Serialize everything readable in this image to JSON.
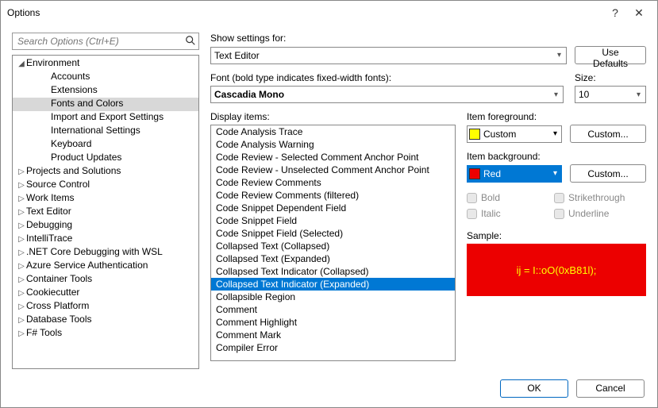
{
  "window": {
    "title": "Options",
    "help_glyph": "?",
    "close_glyph": "✕"
  },
  "search": {
    "placeholder": "Search Options (Ctrl+E)"
  },
  "tree": {
    "items": [
      {
        "label": "Environment",
        "indent": 1,
        "expandable": true,
        "expanded": true
      },
      {
        "label": "Accounts",
        "indent": 2,
        "expandable": false
      },
      {
        "label": "Extensions",
        "indent": 2,
        "expandable": false
      },
      {
        "label": "Fonts and Colors",
        "indent": 2,
        "expandable": false,
        "selected": true
      },
      {
        "label": "Import and Export Settings",
        "indent": 2,
        "expandable": false
      },
      {
        "label": "International Settings",
        "indent": 2,
        "expandable": false
      },
      {
        "label": "Keyboard",
        "indent": 2,
        "expandable": false
      },
      {
        "label": "Product Updates",
        "indent": 2,
        "expandable": false
      },
      {
        "label": "Projects and Solutions",
        "indent": 1,
        "expandable": true,
        "expanded": false
      },
      {
        "label": "Source Control",
        "indent": 1,
        "expandable": true,
        "expanded": false
      },
      {
        "label": "Work Items",
        "indent": 1,
        "expandable": true,
        "expanded": false
      },
      {
        "label": "Text Editor",
        "indent": 1,
        "expandable": true,
        "expanded": false
      },
      {
        "label": "Debugging",
        "indent": 1,
        "expandable": true,
        "expanded": false
      },
      {
        "label": "IntelliTrace",
        "indent": 1,
        "expandable": true,
        "expanded": false
      },
      {
        "label": ".NET Core Debugging with WSL",
        "indent": 1,
        "expandable": true,
        "expanded": false
      },
      {
        "label": "Azure Service Authentication",
        "indent": 1,
        "expandable": true,
        "expanded": false
      },
      {
        "label": "Container Tools",
        "indent": 1,
        "expandable": true,
        "expanded": false
      },
      {
        "label": "Cookiecutter",
        "indent": 1,
        "expandable": true,
        "expanded": false
      },
      {
        "label": "Cross Platform",
        "indent": 1,
        "expandable": true,
        "expanded": false
      },
      {
        "label": "Database Tools",
        "indent": 1,
        "expandable": true,
        "expanded": false
      },
      {
        "label": "F# Tools",
        "indent": 1,
        "expandable": true,
        "expanded": false
      }
    ]
  },
  "settings": {
    "show_for_label": "Show settings for:",
    "show_for_value": "Text Editor",
    "use_defaults": "Use Defaults",
    "font_label": "Font (bold type indicates fixed-width fonts):",
    "font_value": "Cascadia Mono",
    "size_label": "Size:",
    "size_value": "10",
    "display_items_label": "Display items:",
    "display_items": [
      "Code Analysis Trace",
      "Code Analysis Warning",
      "Code Review - Selected Comment Anchor Point",
      "Code Review - Unselected Comment Anchor Point",
      "Code Review Comments",
      "Code Review Comments (filtered)",
      "Code Snippet Dependent Field",
      "Code Snippet Field",
      "Code Snippet Field (Selected)",
      "Collapsed Text (Collapsed)",
      "Collapsed Text (Expanded)",
      "Collapsed Text Indicator (Collapsed)",
      "Collapsed Text Indicator (Expanded)",
      "Collapsible Region",
      "Comment",
      "Comment Highlight",
      "Comment Mark",
      "Compiler Error"
    ],
    "display_selected_index": 12,
    "fg_label": "Item foreground:",
    "fg_value": "Custom",
    "fg_swatch": "#ffff00",
    "fg_custom_btn": "Custom...",
    "bg_label": "Item background:",
    "bg_value": "Red",
    "bg_swatch": "#ec0000",
    "bg_custom_btn": "Custom...",
    "bold": "Bold",
    "strike": "Strikethrough",
    "italic": "Italic",
    "underline": "Underline",
    "sample_label": "Sample:",
    "sample_text": "ij = I::oO(0xB81l);"
  },
  "footer": {
    "ok": "OK",
    "cancel": "Cancel"
  }
}
